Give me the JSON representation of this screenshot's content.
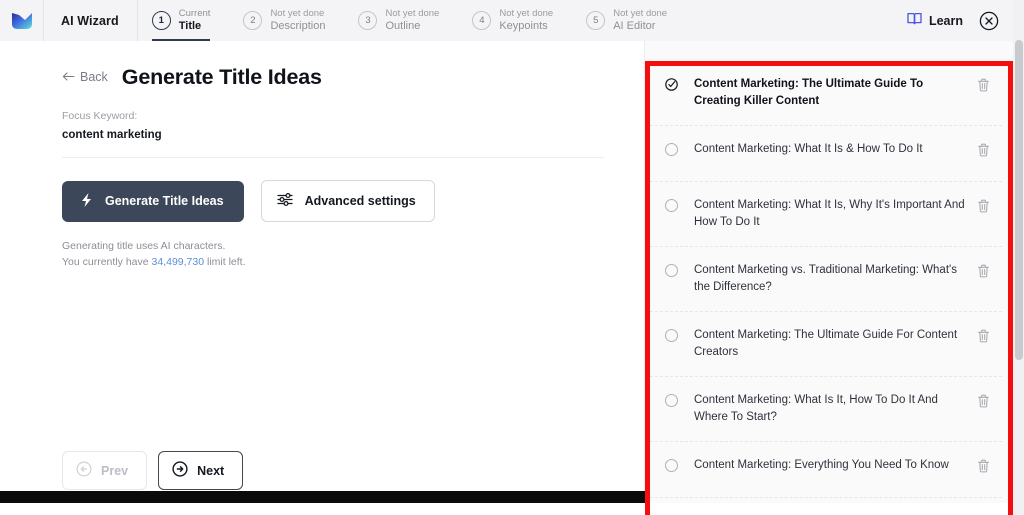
{
  "header": {
    "logo_icon": "app-logo-mark",
    "brand": "AI Wizard",
    "steps": [
      {
        "num": "1",
        "state": "Current",
        "name": "Title"
      },
      {
        "num": "2",
        "state": "Not yet done",
        "name": "Description"
      },
      {
        "num": "3",
        "state": "Not yet done",
        "name": "Outline"
      },
      {
        "num": "4",
        "state": "Not yet done",
        "name": "Keypoints"
      },
      {
        "num": "5",
        "state": "Not yet done",
        "name": "AI Editor"
      }
    ],
    "learn_label": "Learn",
    "learn_icon": "book-icon",
    "close_icon": "close-circle-icon"
  },
  "main": {
    "back_label": "Back",
    "back_icon": "arrow-left-icon",
    "page_title": "Generate Title Ideas",
    "focus_label": "Focus Keyword:",
    "focus_value": "content marketing",
    "generate_label": "Generate Title Ideas",
    "generate_icon": "lightning-bolt-icon",
    "advanced_label": "Advanced settings",
    "advanced_icon": "sliders-icon",
    "usage_line1": "Generating title uses AI characters.",
    "usage_prefix": "You currently have ",
    "usage_limit": "34,499,730",
    "usage_suffix": " limit left.",
    "prev_label": "Prev",
    "prev_icon": "arrow-left-circle-icon",
    "next_label": "Next",
    "next_icon": "arrow-right-circle-icon"
  },
  "titles": {
    "delete_icon": "trash-icon",
    "selected_icon": "check-circle-icon",
    "unselected_icon": "radio-circle-icon",
    "items": [
      {
        "text": "Content Marketing: The Ultimate Guide To Creating Killer Content",
        "selected": true
      },
      {
        "text": "Content Marketing: What It Is & How To Do It",
        "selected": false
      },
      {
        "text": "Content Marketing: What It Is, Why It's Important And How To Do It",
        "selected": false
      },
      {
        "text": "Content Marketing vs. Traditional Marketing: What's the Difference?",
        "selected": false
      },
      {
        "text": "Content Marketing: The Ultimate Guide For Content Creators",
        "selected": false
      },
      {
        "text": "Content Marketing: What Is It, How To Do It And Where To Start?",
        "selected": false
      },
      {
        "text": "Content Marketing: Everything You Need To Know",
        "selected": false
      }
    ]
  },
  "colors": {
    "accent_dark": "#3c4759",
    "highlight_red": "#f60d0d",
    "link_blue": "#5b8fd6",
    "learn_blue": "#4a55e0",
    "header_bg": "#f4f4f6",
    "panel_bg": "#fafafb"
  }
}
